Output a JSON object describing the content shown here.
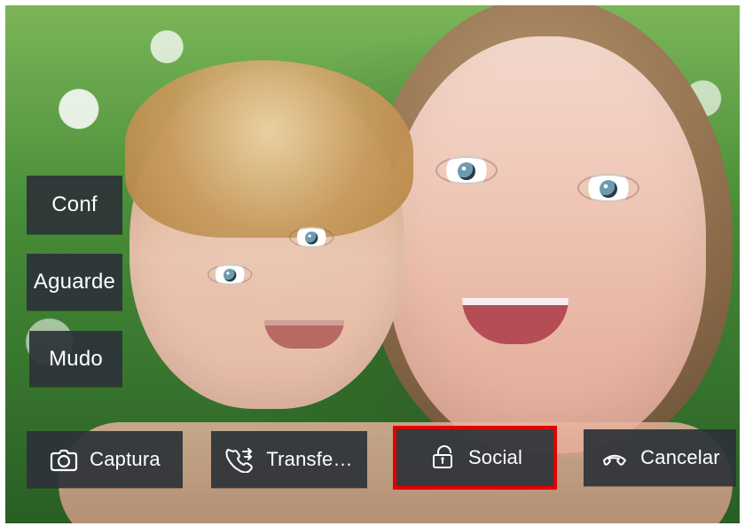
{
  "buttons": {
    "left": [
      {
        "name": "conf-button",
        "label": "Conf"
      },
      {
        "name": "aguarde-button",
        "label": "Aguarde"
      },
      {
        "name": "mudo-button",
        "label": "Mudo"
      }
    ],
    "bottom": [
      {
        "name": "capture-button",
        "label": "Captura",
        "icon": "camera-icon"
      },
      {
        "name": "transfer-button",
        "label": "Transfe…",
        "icon": "phone-transfer-icon"
      },
      {
        "name": "social-button",
        "label": "Social",
        "icon": "unlock-icon",
        "selected": true
      },
      {
        "name": "cancel-button",
        "label": "Cancelar",
        "icon": "hangup-icon"
      }
    ]
  },
  "colors": {
    "selection_outline": "#e00000",
    "button_bg": "#2d3238"
  }
}
